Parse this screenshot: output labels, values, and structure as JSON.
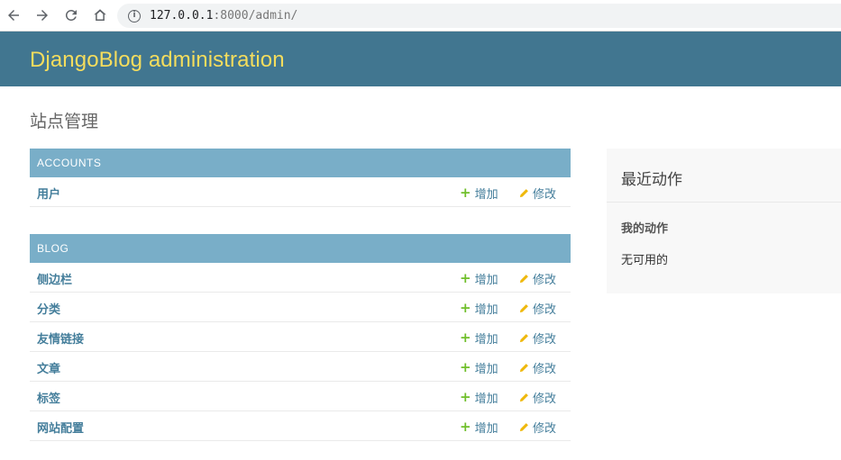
{
  "browser": {
    "url_host": "127.0.0.1",
    "url_rest": ":8000/admin/"
  },
  "header": {
    "site_title": "DjangoBlog administration"
  },
  "page": {
    "title": "站点管理"
  },
  "modules": [
    {
      "caption": "ACCOUNTS",
      "rows": [
        {
          "name": "用户",
          "add": "增加",
          "change": "修改"
        }
      ]
    },
    {
      "caption": "BLOG",
      "rows": [
        {
          "name": "侧边栏",
          "add": "增加",
          "change": "修改"
        },
        {
          "name": "分类",
          "add": "增加",
          "change": "修改"
        },
        {
          "name": "友情链接",
          "add": "增加",
          "change": "修改"
        },
        {
          "name": "文章",
          "add": "增加",
          "change": "修改"
        },
        {
          "name": "标签",
          "add": "增加",
          "change": "修改"
        },
        {
          "name": "网站配置",
          "add": "增加",
          "change": "修改"
        }
      ]
    }
  ],
  "recent_actions": {
    "title": "最近动作",
    "subtitle": "我的动作",
    "empty": "无可用的"
  },
  "colors": {
    "header_bg": "#417690",
    "site_title": "#f5dd5d",
    "caption_bg": "#79aec8",
    "link": "#447e9b",
    "add_icon": "#70bf2b",
    "change_icon": "#efb80b"
  }
}
